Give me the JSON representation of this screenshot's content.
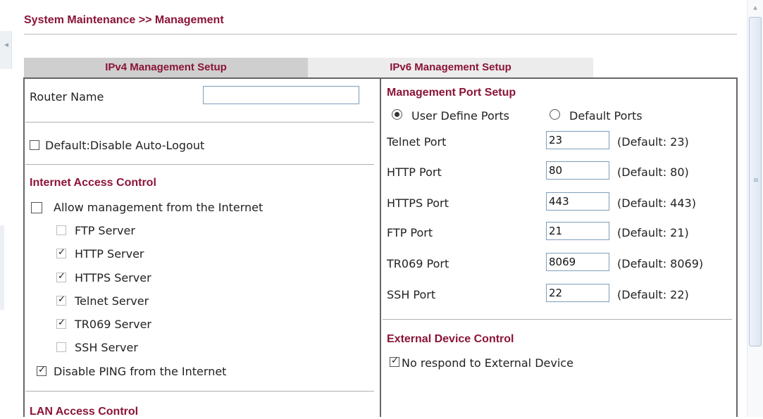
{
  "page_title": "System Maintenance >> Management",
  "tabs": {
    "ipv4": "IPv4 Management Setup",
    "ipv6": "IPv6 Management Setup"
  },
  "left": {
    "router_name_label": "Router Name",
    "router_name_value": "",
    "disable_auto_logout": {
      "label": "Default:Disable Auto-Logout",
      "checked": false
    },
    "internet_access_control": {
      "title": "Internet Access Control",
      "allow_management": {
        "label": "Allow management from the Internet",
        "checked": false
      },
      "servers": [
        {
          "label": "FTP Server",
          "checked": false
        },
        {
          "label": "HTTP Server",
          "checked": true
        },
        {
          "label": "HTTPS Server",
          "checked": true
        },
        {
          "label": "Telnet Server",
          "checked": true
        },
        {
          "label": "TR069 Server",
          "checked": true
        },
        {
          "label": "SSH Server",
          "checked": false
        }
      ],
      "disable_ping": {
        "label": "Disable PING from the Internet",
        "checked": true
      }
    },
    "lan_access_control_title": "LAN Access Control"
  },
  "right": {
    "management_port_setup_title": "Management Port Setup",
    "radio_user_define": "User Define Ports",
    "radio_default": "Default Ports",
    "selected_radio": "user_define",
    "ports": [
      {
        "label": "Telnet Port",
        "value": "23",
        "default": "(Default: 23)"
      },
      {
        "label": "HTTP Port",
        "value": "80",
        "default": "(Default: 80)"
      },
      {
        "label": "HTTPS Port",
        "value": "443",
        "default": "(Default: 443)"
      },
      {
        "label": "FTP Port",
        "value": "21",
        "default": "(Default: 21)"
      },
      {
        "label": "TR069 Port",
        "value": "8069",
        "default": "(Default: 8069)"
      },
      {
        "label": "SSH Port",
        "value": "22",
        "default": "(Default: 22)"
      }
    ],
    "external_device_control_title": "External Device Control",
    "no_respond_external": {
      "label": "No respond to External Device",
      "checked": true
    }
  },
  "colors": {
    "section_title": "#8b1438",
    "active_tab": "#cfcfcf",
    "inactive_tab": "#ececec",
    "border": "#666666",
    "input_border": "#7f9db9"
  },
  "icons": {
    "checkbox_checked": "check-icon",
    "radio_selected": "radio-dot-icon",
    "scroll_up": "chevron-up-icon",
    "scroll_grip": "grip-icon"
  }
}
